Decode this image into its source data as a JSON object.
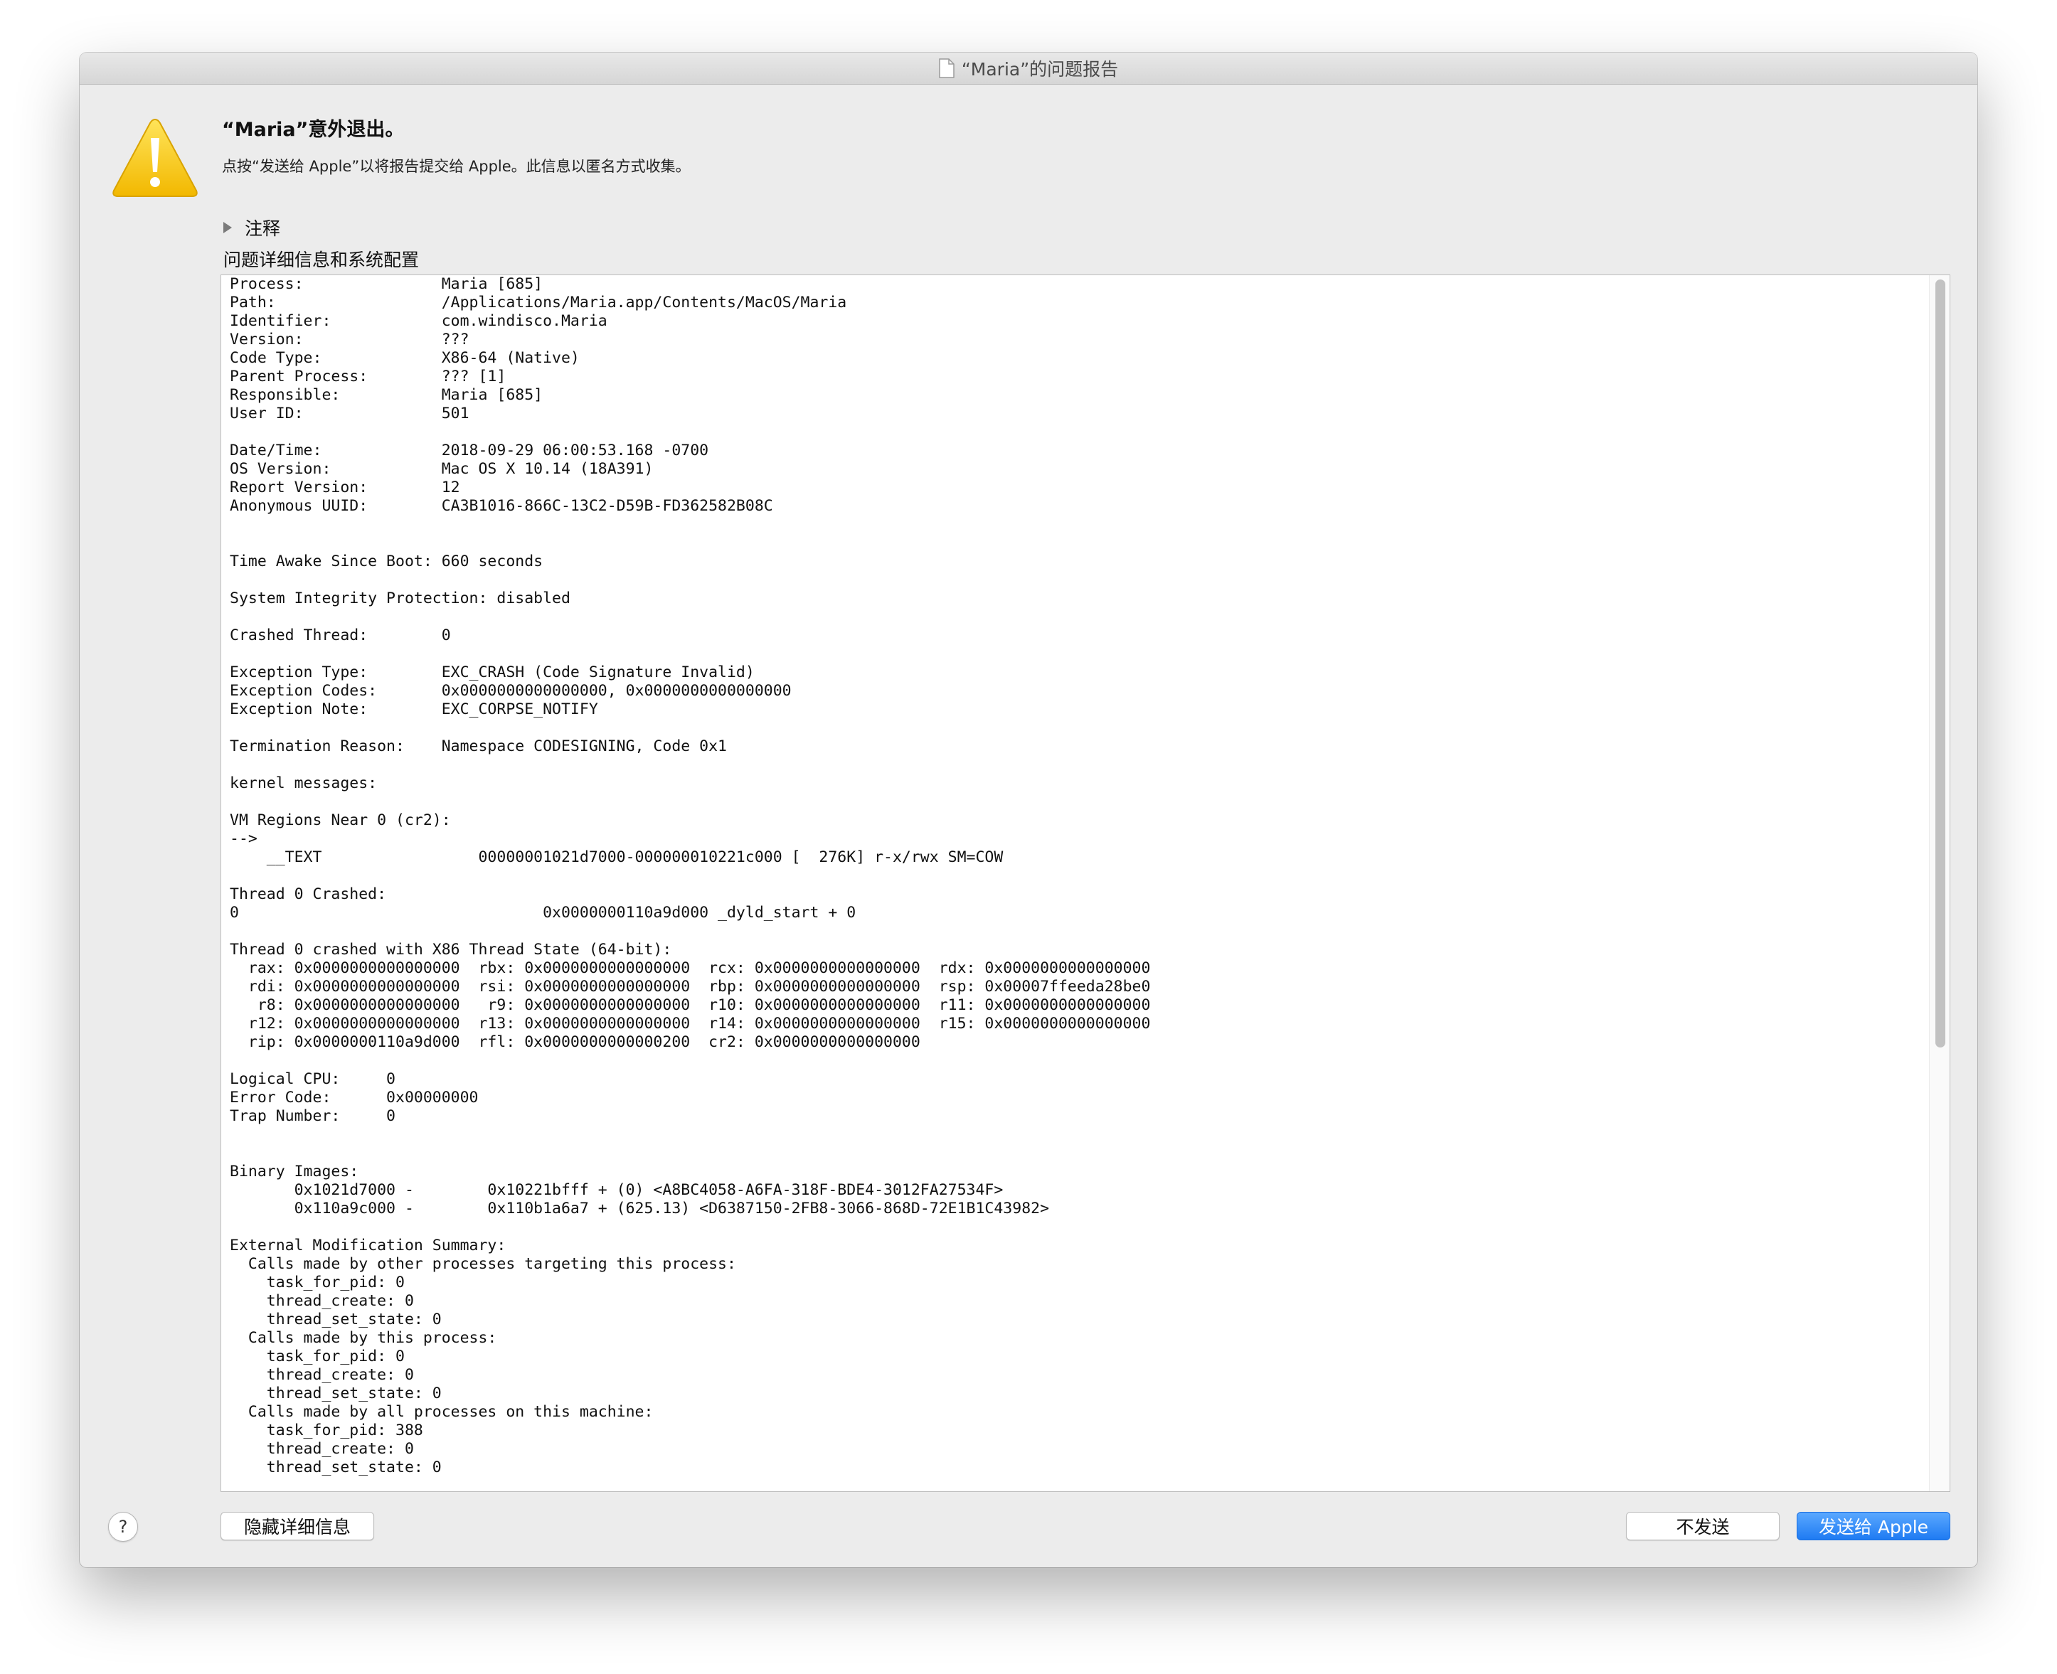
{
  "window": {
    "title": "“Maria”的问题报告"
  },
  "alert": {
    "heading": "“Maria”意外退出。",
    "message": "点按“发送给 Apple”以将报告提交给 Apple。此信息以匿名方式收集。"
  },
  "comments": {
    "label": "注释"
  },
  "details": {
    "label": "问题详细信息和系统配置",
    "report": "Process:               Maria [685]\nPath:                  /Applications/Maria.app/Contents/MacOS/Maria\nIdentifier:            com.windisco.Maria\nVersion:               ???\nCode Type:             X86-64 (Native)\nParent Process:        ??? [1]\nResponsible:           Maria [685]\nUser ID:               501\n\nDate/Time:             2018-09-29 06:00:53.168 -0700\nOS Version:            Mac OS X 10.14 (18A391)\nReport Version:        12\nAnonymous UUID:        CA3B1016-866C-13C2-D59B-FD362582B08C\n\n\nTime Awake Since Boot: 660 seconds\n\nSystem Integrity Protection: disabled\n\nCrashed Thread:        0\n\nException Type:        EXC_CRASH (Code Signature Invalid)\nException Codes:       0x0000000000000000, 0x0000000000000000\nException Note:        EXC_CORPSE_NOTIFY\n\nTermination Reason:    Namespace CODESIGNING, Code 0x1\n\nkernel messages:\n\nVM Regions Near 0 (cr2):\n-->\n    __TEXT                 00000001021d7000-000000010221c000 [  276K] r-x/rwx SM=COW\n\nThread 0 Crashed:\n0                                 0x0000000110a9d000 _dyld_start + 0\n\nThread 0 crashed with X86 Thread State (64-bit):\n  rax: 0x0000000000000000  rbx: 0x0000000000000000  rcx: 0x0000000000000000  rdx: 0x0000000000000000\n  rdi: 0x0000000000000000  rsi: 0x0000000000000000  rbp: 0x0000000000000000  rsp: 0x00007ffeeda28be0\n   r8: 0x0000000000000000   r9: 0x0000000000000000  r10: 0x0000000000000000  r11: 0x0000000000000000\n  r12: 0x0000000000000000  r13: 0x0000000000000000  r14: 0x0000000000000000  r15: 0x0000000000000000\n  rip: 0x0000000110a9d000  rfl: 0x0000000000000200  cr2: 0x0000000000000000\n\nLogical CPU:     0\nError Code:      0x00000000\nTrap Number:     0\n\n\nBinary Images:\n       0x1021d7000 -        0x10221bfff + (0) <A8BC4058-A6FA-318F-BDE4-3012FA27534F>\n       0x110a9c000 -        0x110b1a6a7 + (625.13) <D6387150-2FB8-3066-868D-72E1B1C43982>\n\nExternal Modification Summary:\n  Calls made by other processes targeting this process:\n    task_for_pid: 0\n    thread_create: 0\n    thread_set_state: 0\n  Calls made by this process:\n    task_for_pid: 0\n    thread_create: 0\n    thread_set_state: 0\n  Calls made by all processes on this machine:\n    task_for_pid: 388\n    thread_create: 0\n    thread_set_state: 0"
  },
  "buttons": {
    "help": "?",
    "hide_details": "隐藏详细信息",
    "dont_send": "不发送",
    "send": "发送给 Apple"
  },
  "colors": {
    "accent": "#1f7bf2",
    "warning": "#f5c400"
  },
  "icons": {
    "title": "document-icon",
    "alert": "warning-icon",
    "disclosure": "disclosure-triangle-icon"
  }
}
